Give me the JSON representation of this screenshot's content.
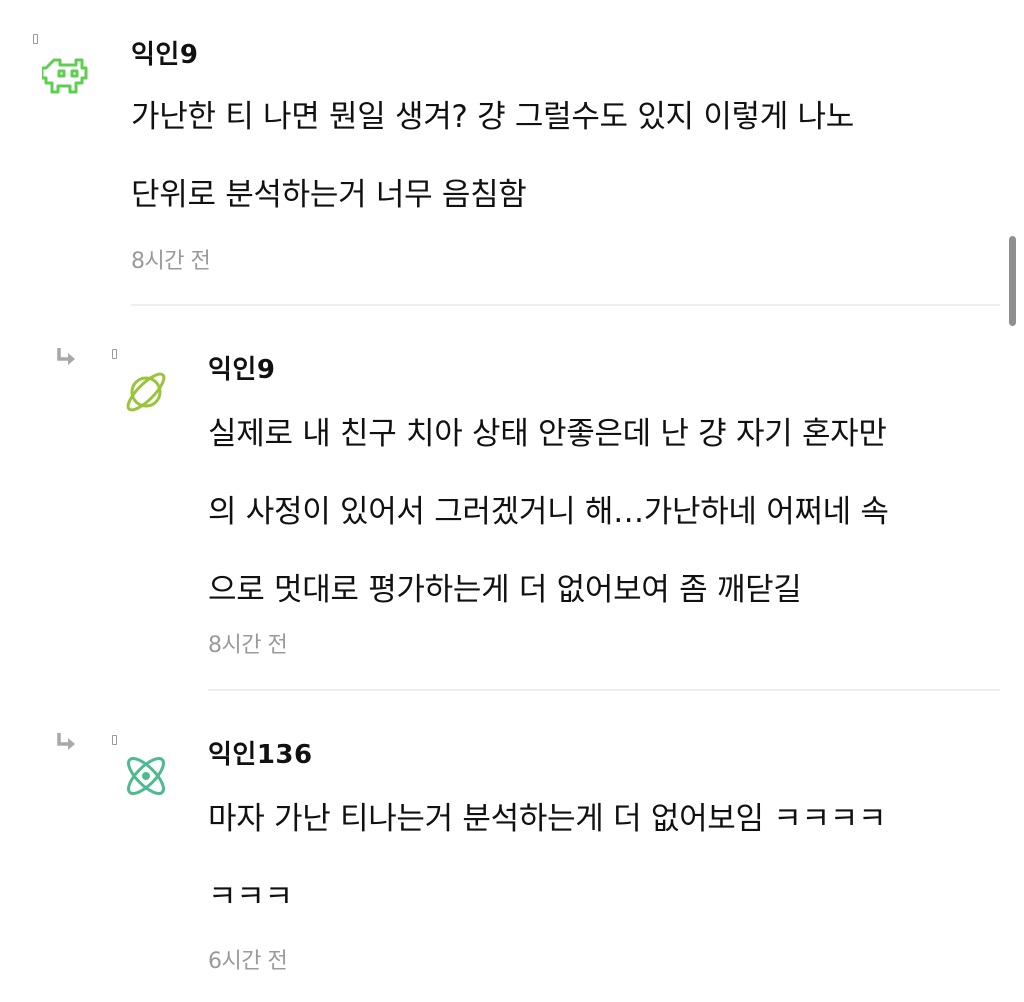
{
  "comments": [
    {
      "author": "익인9",
      "avatar_icon": "space-invader-icon",
      "avatar_color": "#5ccf4f",
      "lines": [
        "가난한 티 나면 뭔일 생겨? 걍 그럴수도 있지 이렇게 나노",
        "단위로 분석하는거 너무 음침함"
      ],
      "time": "8시간 전"
    },
    {
      "author": "익인9",
      "avatar_icon": "planet-icon",
      "avatar_color": "#9cc43a",
      "lines": [
        "실제로 내 친구 치아 상태 안좋은데 난 걍 자기 혼자만",
        "의 사정이 있어서 그러겠거니 해…가난하네 어쩌네 속",
        "으로 멋대로 평가하는게 더 없어보여 좀 깨닫길"
      ],
      "time": "8시간 전"
    },
    {
      "author": "익인136",
      "avatar_icon": "atom-icon",
      "avatar_color": "#4fba8f",
      "lines": [
        "마자 가난 티나는거 분석하는게 더 없어보임 ㅋㅋㅋㅋ",
        "ㅋㅋㅋ"
      ],
      "time": "6시간 전"
    }
  ]
}
